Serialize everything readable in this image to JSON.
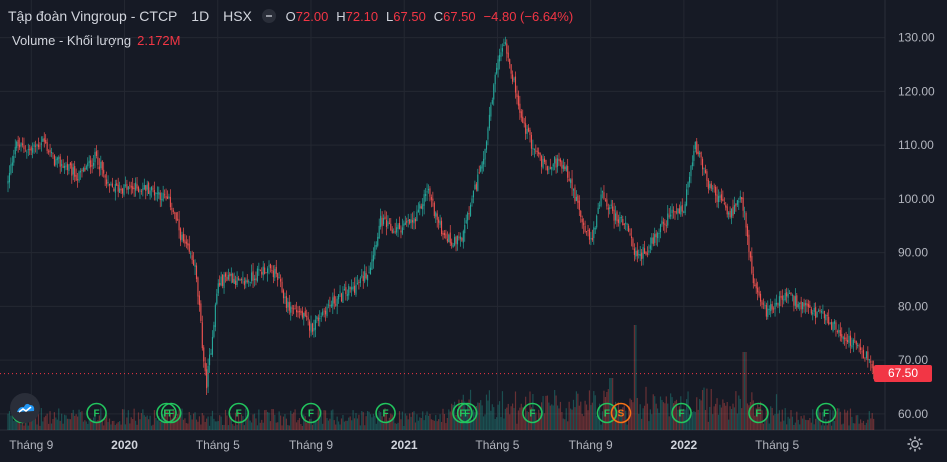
{
  "header": {
    "title": "Tập đoàn Vingroup - CTCP",
    "interval": "1D",
    "exchange": "HSX",
    "ohlc": [
      {
        "key": "O",
        "value": "72.00"
      },
      {
        "key": "H",
        "value": "72.10"
      },
      {
        "key": "L",
        "value": "67.50"
      },
      {
        "key": "C",
        "value": "67.50"
      }
    ],
    "change": "−4.80 (−6.64%)",
    "volume_label": "Volume - Khối lượng",
    "volume_value": "2.172M"
  },
  "colors": {
    "background": "#161a25",
    "grid": "#242832",
    "up": "#26a69a",
    "down": "#ef5350",
    "event_green": "#22c55e",
    "event_orange": "#f97316",
    "last_price": "#f23645"
  },
  "chart_data": {
    "type": "candlestick",
    "title": "Tập đoàn Vingroup - CTCP",
    "interval": "1D",
    "exchange": "HSX",
    "last_price": 67.5,
    "last_price_label": "67.50",
    "ylim": [
      57,
      137
    ],
    "y_ticks": [
      {
        "value": 60,
        "label": "60.00"
      },
      {
        "value": 70,
        "label": "70.00"
      },
      {
        "value": 80,
        "label": "80.00"
      },
      {
        "value": 90,
        "label": "90.00"
      },
      {
        "value": 100,
        "label": "100.00"
      },
      {
        "value": 110,
        "label": "110.00"
      },
      {
        "value": 120,
        "label": "120.00"
      },
      {
        "value": 130,
        "label": "130.00"
      }
    ],
    "x_ticks": [
      {
        "label": "Tháng 9",
        "month": 1,
        "year": false
      },
      {
        "label": "2020",
        "month": 5,
        "year": true
      },
      {
        "label": "Tháng 5",
        "month": 9,
        "year": false
      },
      {
        "label": "Tháng 9",
        "month": 13,
        "year": false
      },
      {
        "label": "2021",
        "month": 17,
        "year": true
      },
      {
        "label": "Tháng 5",
        "month": 21,
        "year": false
      },
      {
        "label": "Tháng 9",
        "month": 25,
        "year": false
      },
      {
        "label": "2022",
        "month": 29,
        "year": true
      },
      {
        "label": "Tháng 5",
        "month": 33,
        "year": false
      }
    ],
    "month_range": [
      0,
      37.2
    ],
    "price_path": [
      [
        0,
        103
      ],
      [
        0.3,
        110
      ],
      [
        1,
        109
      ],
      [
        1.5,
        111
      ],
      [
        2,
        107
      ],
      [
        2.5,
        106
      ],
      [
        3,
        104
      ],
      [
        3.8,
        108
      ],
      [
        4.3,
        102
      ],
      [
        5,
        102
      ],
      [
        6,
        102
      ],
      [
        6.5,
        101
      ],
      [
        7,
        99
      ],
      [
        7.5,
        92
      ],
      [
        8,
        88
      ],
      [
        8.2,
        80
      ],
      [
        8.5,
        65
      ],
      [
        8.7,
        72
      ],
      [
        9,
        84
      ],
      [
        9.5,
        86
      ],
      [
        10,
        84
      ],
      [
        11,
        87
      ],
      [
        11.5,
        86
      ],
      [
        12,
        80
      ],
      [
        12.5,
        79
      ],
      [
        13,
        76
      ],
      [
        13.5,
        79
      ],
      [
        14,
        81
      ],
      [
        15,
        84
      ],
      [
        15.5,
        87
      ],
      [
        16,
        96
      ],
      [
        16.5,
        94
      ],
      [
        17,
        95
      ],
      [
        17.5,
        96
      ],
      [
        18,
        102
      ],
      [
        18.5,
        95
      ],
      [
        19,
        92
      ],
      [
        19.5,
        93
      ],
      [
        20,
        101
      ],
      [
        20.5,
        110
      ],
      [
        21,
        125
      ],
      [
        21.3,
        130
      ],
      [
        21.6,
        124
      ],
      [
        22,
        115
      ],
      [
        22.5,
        110
      ],
      [
        23,
        106
      ],
      [
        23.5,
        107
      ],
      [
        24,
        105
      ],
      [
        24.5,
        98
      ],
      [
        25,
        92
      ],
      [
        25.5,
        101
      ],
      [
        26,
        97
      ],
      [
        26.5,
        95
      ],
      [
        27,
        89
      ],
      [
        27.5,
        91
      ],
      [
        28,
        95
      ],
      [
        28.5,
        97
      ],
      [
        29,
        98
      ],
      [
        29.5,
        110
      ],
      [
        30,
        103
      ],
      [
        30.5,
        100
      ],
      [
        31,
        97
      ],
      [
        31.5,
        100
      ],
      [
        32,
        84
      ],
      [
        32.5,
        79
      ],
      [
        33,
        81
      ],
      [
        33.5,
        82
      ],
      [
        34,
        80
      ],
      [
        34.5,
        79
      ],
      [
        35,
        78
      ],
      [
        35.5,
        76
      ],
      [
        36,
        74
      ],
      [
        36.5,
        72
      ],
      [
        37,
        70
      ],
      [
        37.2,
        67.5
      ]
    ],
    "events": [
      {
        "label": "F",
        "month": 0.6,
        "color": "green"
      },
      {
        "label": "F",
        "month": 3.8,
        "color": "green"
      },
      {
        "label": "F",
        "month": 6.8,
        "color": "green"
      },
      {
        "label": "F",
        "month": 7.0,
        "color": "green"
      },
      {
        "label": "F",
        "month": 9.9,
        "color": "green"
      },
      {
        "label": "F",
        "month": 13.0,
        "color": "green"
      },
      {
        "label": "F",
        "month": 16.2,
        "color": "green"
      },
      {
        "label": "F",
        "month": 19.5,
        "color": "green"
      },
      {
        "label": "F",
        "month": 19.7,
        "color": "green"
      },
      {
        "label": "F",
        "month": 22.5,
        "color": "green"
      },
      {
        "label": "F",
        "month": 25.7,
        "color": "green"
      },
      {
        "label": "S",
        "month": 26.3,
        "color": "orange"
      },
      {
        "label": "F",
        "month": 28.9,
        "color": "green"
      },
      {
        "label": "F",
        "month": 32.2,
        "color": "green"
      },
      {
        "label": "F",
        "month": 35.1,
        "color": "green"
      }
    ]
  }
}
